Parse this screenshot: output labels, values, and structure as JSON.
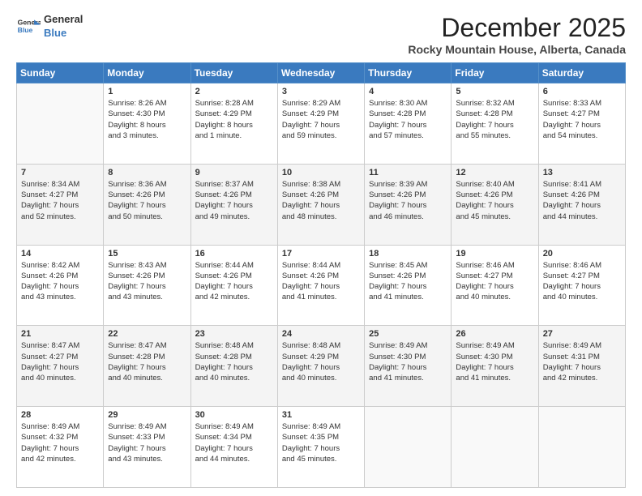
{
  "logo": {
    "line1": "General",
    "line2": "Blue"
  },
  "title": "December 2025",
  "location": "Rocky Mountain House, Alberta, Canada",
  "days_header": [
    "Sunday",
    "Monday",
    "Tuesday",
    "Wednesday",
    "Thursday",
    "Friday",
    "Saturday"
  ],
  "weeks": [
    [
      {
        "day": "",
        "info": ""
      },
      {
        "day": "1",
        "info": "Sunrise: 8:26 AM\nSunset: 4:30 PM\nDaylight: 8 hours\nand 3 minutes."
      },
      {
        "day": "2",
        "info": "Sunrise: 8:28 AM\nSunset: 4:29 PM\nDaylight: 8 hours\nand 1 minute."
      },
      {
        "day": "3",
        "info": "Sunrise: 8:29 AM\nSunset: 4:29 PM\nDaylight: 7 hours\nand 59 minutes."
      },
      {
        "day": "4",
        "info": "Sunrise: 8:30 AM\nSunset: 4:28 PM\nDaylight: 7 hours\nand 57 minutes."
      },
      {
        "day": "5",
        "info": "Sunrise: 8:32 AM\nSunset: 4:28 PM\nDaylight: 7 hours\nand 55 minutes."
      },
      {
        "day": "6",
        "info": "Sunrise: 8:33 AM\nSunset: 4:27 PM\nDaylight: 7 hours\nand 54 minutes."
      }
    ],
    [
      {
        "day": "7",
        "info": "Sunrise: 8:34 AM\nSunset: 4:27 PM\nDaylight: 7 hours\nand 52 minutes."
      },
      {
        "day": "8",
        "info": "Sunrise: 8:36 AM\nSunset: 4:26 PM\nDaylight: 7 hours\nand 50 minutes."
      },
      {
        "day": "9",
        "info": "Sunrise: 8:37 AM\nSunset: 4:26 PM\nDaylight: 7 hours\nand 49 minutes."
      },
      {
        "day": "10",
        "info": "Sunrise: 8:38 AM\nSunset: 4:26 PM\nDaylight: 7 hours\nand 48 minutes."
      },
      {
        "day": "11",
        "info": "Sunrise: 8:39 AM\nSunset: 4:26 PM\nDaylight: 7 hours\nand 46 minutes."
      },
      {
        "day": "12",
        "info": "Sunrise: 8:40 AM\nSunset: 4:26 PM\nDaylight: 7 hours\nand 45 minutes."
      },
      {
        "day": "13",
        "info": "Sunrise: 8:41 AM\nSunset: 4:26 PM\nDaylight: 7 hours\nand 44 minutes."
      }
    ],
    [
      {
        "day": "14",
        "info": "Sunrise: 8:42 AM\nSunset: 4:26 PM\nDaylight: 7 hours\nand 43 minutes."
      },
      {
        "day": "15",
        "info": "Sunrise: 8:43 AM\nSunset: 4:26 PM\nDaylight: 7 hours\nand 43 minutes."
      },
      {
        "day": "16",
        "info": "Sunrise: 8:44 AM\nSunset: 4:26 PM\nDaylight: 7 hours\nand 42 minutes."
      },
      {
        "day": "17",
        "info": "Sunrise: 8:44 AM\nSunset: 4:26 PM\nDaylight: 7 hours\nand 41 minutes."
      },
      {
        "day": "18",
        "info": "Sunrise: 8:45 AM\nSunset: 4:26 PM\nDaylight: 7 hours\nand 41 minutes."
      },
      {
        "day": "19",
        "info": "Sunrise: 8:46 AM\nSunset: 4:27 PM\nDaylight: 7 hours\nand 40 minutes."
      },
      {
        "day": "20",
        "info": "Sunrise: 8:46 AM\nSunset: 4:27 PM\nDaylight: 7 hours\nand 40 minutes."
      }
    ],
    [
      {
        "day": "21",
        "info": "Sunrise: 8:47 AM\nSunset: 4:27 PM\nDaylight: 7 hours\nand 40 minutes."
      },
      {
        "day": "22",
        "info": "Sunrise: 8:47 AM\nSunset: 4:28 PM\nDaylight: 7 hours\nand 40 minutes."
      },
      {
        "day": "23",
        "info": "Sunrise: 8:48 AM\nSunset: 4:28 PM\nDaylight: 7 hours\nand 40 minutes."
      },
      {
        "day": "24",
        "info": "Sunrise: 8:48 AM\nSunset: 4:29 PM\nDaylight: 7 hours\nand 40 minutes."
      },
      {
        "day": "25",
        "info": "Sunrise: 8:49 AM\nSunset: 4:30 PM\nDaylight: 7 hours\nand 41 minutes."
      },
      {
        "day": "26",
        "info": "Sunrise: 8:49 AM\nSunset: 4:30 PM\nDaylight: 7 hours\nand 41 minutes."
      },
      {
        "day": "27",
        "info": "Sunrise: 8:49 AM\nSunset: 4:31 PM\nDaylight: 7 hours\nand 42 minutes."
      }
    ],
    [
      {
        "day": "28",
        "info": "Sunrise: 8:49 AM\nSunset: 4:32 PM\nDaylight: 7 hours\nand 42 minutes."
      },
      {
        "day": "29",
        "info": "Sunrise: 8:49 AM\nSunset: 4:33 PM\nDaylight: 7 hours\nand 43 minutes."
      },
      {
        "day": "30",
        "info": "Sunrise: 8:49 AM\nSunset: 4:34 PM\nDaylight: 7 hours\nand 44 minutes."
      },
      {
        "day": "31",
        "info": "Sunrise: 8:49 AM\nSunset: 4:35 PM\nDaylight: 7 hours\nand 45 minutes."
      },
      {
        "day": "",
        "info": ""
      },
      {
        "day": "",
        "info": ""
      },
      {
        "day": "",
        "info": ""
      }
    ]
  ]
}
